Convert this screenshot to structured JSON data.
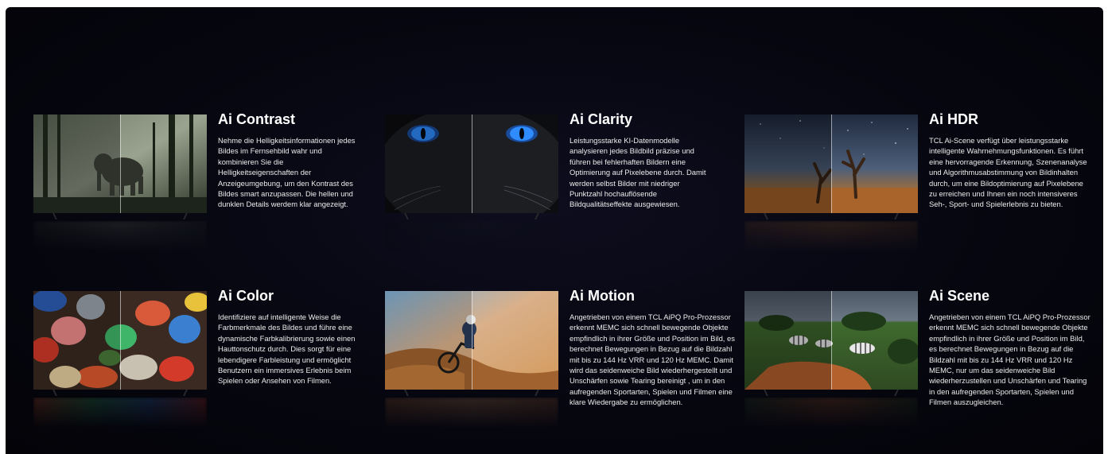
{
  "features": [
    {
      "title": "Ai Contrast",
      "description": "Nehme die Helligkeitsinformationen jedes Bildes im Fernsehbild wahr und kombinieren Sie die Helligkeitseigenschaften der Anzeigeumgebung, um den Kontrast des Bildes smart anzupassen. Die hellen und dunklen Details werdem klar angezeigt.",
      "image": "elephant-forest",
      "colors": {
        "sky": "#8e9a8a",
        "mid": "#3f4a3c",
        "ground": "#1d241b"
      }
    },
    {
      "title": "Ai Clarity",
      "description": "Leistungsstarke KI-Datenmodelle analysieren jedes Bildbild präzise und führen bei fehlerhaften Bildern eine Optimierung auf Pixelebene durch. Damit werden selbst Bilder mit niedriger Punktzahl hochauflösende Bildqualitätseffekte ausgewiesen.",
      "image": "black-cat-blue-eyes",
      "colors": {
        "fur": "#1c1e22",
        "eye": "#2f8cff",
        "shade": "#08090b"
      }
    },
    {
      "title": "Ai HDR",
      "description": "TCL Ai-Scene verfügt über leistungsstarke intelligente Wahrnehmungsfunktionen. Es führt eine hervorragende Erkennung, Szenenanalyse und Algorithmusabstimmung von Bildinhalten durch, um eine Bildoptimierung auf Pixelebene zu erreichen und Ihnen ein noch intensiveres Seh-, Sport- und Spielerlebnis zu bieten.",
      "image": "dead-trees-night-sky",
      "colors": {
        "sky": "#3a4a62",
        "horizon": "#8a6a4a",
        "ground": "#b5722e"
      }
    },
    {
      "title": "Ai Color",
      "description": "Identifiziere auf intelligente Weise die Farbmerkmale des Bildes und führe eine dynamische Farbkalibrierung sowie einen Hautton­schutz durch. Dies sorgt für eine lebendigere Farbleistung und ermöglicht Benutzern ein immersives Erlebnis beim Spielen oder Ansehen von Filmen.",
      "image": "colorful-stones",
      "colors": {
        "a": "#e0553a",
        "b": "#3a7fd0",
        "c": "#3fb56a",
        "d": "#e8c23a"
      }
    },
    {
      "title": "Ai Motion",
      "description": "Angetrieben von einem TCL AiPQ Pro-Prozessor erkennt MEMC sich schnell bewegende Objekte empfindlich in ihrer Größe und Position im Bild, es berechnet Bewegungen in Bezug auf die Bildzahl mit bis zu 144 Hz VRR und 120 Hz MEMC. Damit wird das seidenweiche Bild wiederhergestellt und Unschärfen sowie Tearing bereinigt , um in den aufregenden Sportarten, Spielen und Filmen eine klare Wiedergabe zu ermöglichen.",
      "image": "mountain-biker-dust",
      "colors": {
        "sky": "#7fb0d6",
        "dust": "#d49a5c",
        "ground": "#a0622e"
      }
    },
    {
      "title": "Ai Scene",
      "description": "Angetrieben von einem TCL AiPQ Pro-Prozessor erkennt MEMC sich schnell bewegende Objekte empfindlich in ihrer Größe und Position im Bild, es berechnet Bewegungen in Bezug auf die Bildzahl mit bis zu 144 Hz VRR und 120 Hz MEMC, nur um das seidenweiche Bild wiederherzustellen und Unschärfen und Tearing in den aufregenden Sportarten, Spielen und Filmen auszugleichen.",
      "image": "zebras-savanna",
      "colors": {
        "sky": "#5d6a78",
        "grass": "#3f6a2e",
        "road": "#b5612e"
      }
    }
  ]
}
